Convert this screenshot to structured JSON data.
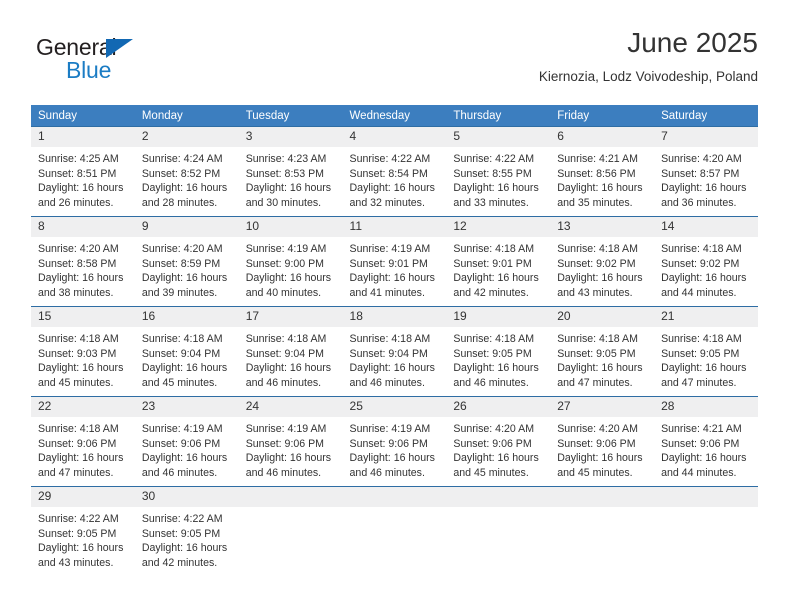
{
  "logo": {
    "primary_text": "General",
    "secondary_text": "Blue",
    "primary_color": "#231f20",
    "secondary_color": "#1b7cc4",
    "triangle_color": "#1268b3",
    "icon": "triangle-icon"
  },
  "header": {
    "title": "June 2025",
    "subtitle": "Kiernozia, Lodz Voivodeship, Poland"
  },
  "theme": {
    "header_background": "#3c7ebf",
    "header_text": "#ffffff",
    "row_divider": "#2e6da4",
    "daynum_background": "#efeff0",
    "text": "#333333"
  },
  "weekdays": [
    "Sunday",
    "Monday",
    "Tuesday",
    "Wednesday",
    "Thursday",
    "Friday",
    "Saturday"
  ],
  "labels": {
    "sunrise_prefix": "Sunrise:",
    "sunset_prefix": "Sunset:",
    "daylight_prefix": "Daylight:"
  },
  "weeks": [
    [
      {
        "day": "1",
        "sunrise": "Sunrise: 4:25 AM",
        "sunset": "Sunset: 8:51 PM",
        "daylight": "Daylight: 16 hours and 26 minutes."
      },
      {
        "day": "2",
        "sunrise": "Sunrise: 4:24 AM",
        "sunset": "Sunset: 8:52 PM",
        "daylight": "Daylight: 16 hours and 28 minutes."
      },
      {
        "day": "3",
        "sunrise": "Sunrise: 4:23 AM",
        "sunset": "Sunset: 8:53 PM",
        "daylight": "Daylight: 16 hours and 30 minutes."
      },
      {
        "day": "4",
        "sunrise": "Sunrise: 4:22 AM",
        "sunset": "Sunset: 8:54 PM",
        "daylight": "Daylight: 16 hours and 32 minutes."
      },
      {
        "day": "5",
        "sunrise": "Sunrise: 4:22 AM",
        "sunset": "Sunset: 8:55 PM",
        "daylight": "Daylight: 16 hours and 33 minutes."
      },
      {
        "day": "6",
        "sunrise": "Sunrise: 4:21 AM",
        "sunset": "Sunset: 8:56 PM",
        "daylight": "Daylight: 16 hours and 35 minutes."
      },
      {
        "day": "7",
        "sunrise": "Sunrise: 4:20 AM",
        "sunset": "Sunset: 8:57 PM",
        "daylight": "Daylight: 16 hours and 36 minutes."
      }
    ],
    [
      {
        "day": "8",
        "sunrise": "Sunrise: 4:20 AM",
        "sunset": "Sunset: 8:58 PM",
        "daylight": "Daylight: 16 hours and 38 minutes."
      },
      {
        "day": "9",
        "sunrise": "Sunrise: 4:20 AM",
        "sunset": "Sunset: 8:59 PM",
        "daylight": "Daylight: 16 hours and 39 minutes."
      },
      {
        "day": "10",
        "sunrise": "Sunrise: 4:19 AM",
        "sunset": "Sunset: 9:00 PM",
        "daylight": "Daylight: 16 hours and 40 minutes."
      },
      {
        "day": "11",
        "sunrise": "Sunrise: 4:19 AM",
        "sunset": "Sunset: 9:01 PM",
        "daylight": "Daylight: 16 hours and 41 minutes."
      },
      {
        "day": "12",
        "sunrise": "Sunrise: 4:18 AM",
        "sunset": "Sunset: 9:01 PM",
        "daylight": "Daylight: 16 hours and 42 minutes."
      },
      {
        "day": "13",
        "sunrise": "Sunrise: 4:18 AM",
        "sunset": "Sunset: 9:02 PM",
        "daylight": "Daylight: 16 hours and 43 minutes."
      },
      {
        "day": "14",
        "sunrise": "Sunrise: 4:18 AM",
        "sunset": "Sunset: 9:02 PM",
        "daylight": "Daylight: 16 hours and 44 minutes."
      }
    ],
    [
      {
        "day": "15",
        "sunrise": "Sunrise: 4:18 AM",
        "sunset": "Sunset: 9:03 PM",
        "daylight": "Daylight: 16 hours and 45 minutes."
      },
      {
        "day": "16",
        "sunrise": "Sunrise: 4:18 AM",
        "sunset": "Sunset: 9:04 PM",
        "daylight": "Daylight: 16 hours and 45 minutes."
      },
      {
        "day": "17",
        "sunrise": "Sunrise: 4:18 AM",
        "sunset": "Sunset: 9:04 PM",
        "daylight": "Daylight: 16 hours and 46 minutes."
      },
      {
        "day": "18",
        "sunrise": "Sunrise: 4:18 AM",
        "sunset": "Sunset: 9:04 PM",
        "daylight": "Daylight: 16 hours and 46 minutes."
      },
      {
        "day": "19",
        "sunrise": "Sunrise: 4:18 AM",
        "sunset": "Sunset: 9:05 PM",
        "daylight": "Daylight: 16 hours and 46 minutes."
      },
      {
        "day": "20",
        "sunrise": "Sunrise: 4:18 AM",
        "sunset": "Sunset: 9:05 PM",
        "daylight": "Daylight: 16 hours and 47 minutes."
      },
      {
        "day": "21",
        "sunrise": "Sunrise: 4:18 AM",
        "sunset": "Sunset: 9:05 PM",
        "daylight": "Daylight: 16 hours and 47 minutes."
      }
    ],
    [
      {
        "day": "22",
        "sunrise": "Sunrise: 4:18 AM",
        "sunset": "Sunset: 9:06 PM",
        "daylight": "Daylight: 16 hours and 47 minutes."
      },
      {
        "day": "23",
        "sunrise": "Sunrise: 4:19 AM",
        "sunset": "Sunset: 9:06 PM",
        "daylight": "Daylight: 16 hours and 46 minutes."
      },
      {
        "day": "24",
        "sunrise": "Sunrise: 4:19 AM",
        "sunset": "Sunset: 9:06 PM",
        "daylight": "Daylight: 16 hours and 46 minutes."
      },
      {
        "day": "25",
        "sunrise": "Sunrise: 4:19 AM",
        "sunset": "Sunset: 9:06 PM",
        "daylight": "Daylight: 16 hours and 46 minutes."
      },
      {
        "day": "26",
        "sunrise": "Sunrise: 4:20 AM",
        "sunset": "Sunset: 9:06 PM",
        "daylight": "Daylight: 16 hours and 45 minutes."
      },
      {
        "day": "27",
        "sunrise": "Sunrise: 4:20 AM",
        "sunset": "Sunset: 9:06 PM",
        "daylight": "Daylight: 16 hours and 45 minutes."
      },
      {
        "day": "28",
        "sunrise": "Sunrise: 4:21 AM",
        "sunset": "Sunset: 9:06 PM",
        "daylight": "Daylight: 16 hours and 44 minutes."
      }
    ],
    [
      {
        "day": "29",
        "sunrise": "Sunrise: 4:22 AM",
        "sunset": "Sunset: 9:05 PM",
        "daylight": "Daylight: 16 hours and 43 minutes."
      },
      {
        "day": "30",
        "sunrise": "Sunrise: 4:22 AM",
        "sunset": "Sunset: 9:05 PM",
        "daylight": "Daylight: 16 hours and 42 minutes."
      },
      {
        "day": "",
        "sunrise": "",
        "sunset": "",
        "daylight": ""
      },
      {
        "day": "",
        "sunrise": "",
        "sunset": "",
        "daylight": ""
      },
      {
        "day": "",
        "sunrise": "",
        "sunset": "",
        "daylight": ""
      },
      {
        "day": "",
        "sunrise": "",
        "sunset": "",
        "daylight": ""
      },
      {
        "day": "",
        "sunrise": "",
        "sunset": "",
        "daylight": ""
      }
    ]
  ]
}
